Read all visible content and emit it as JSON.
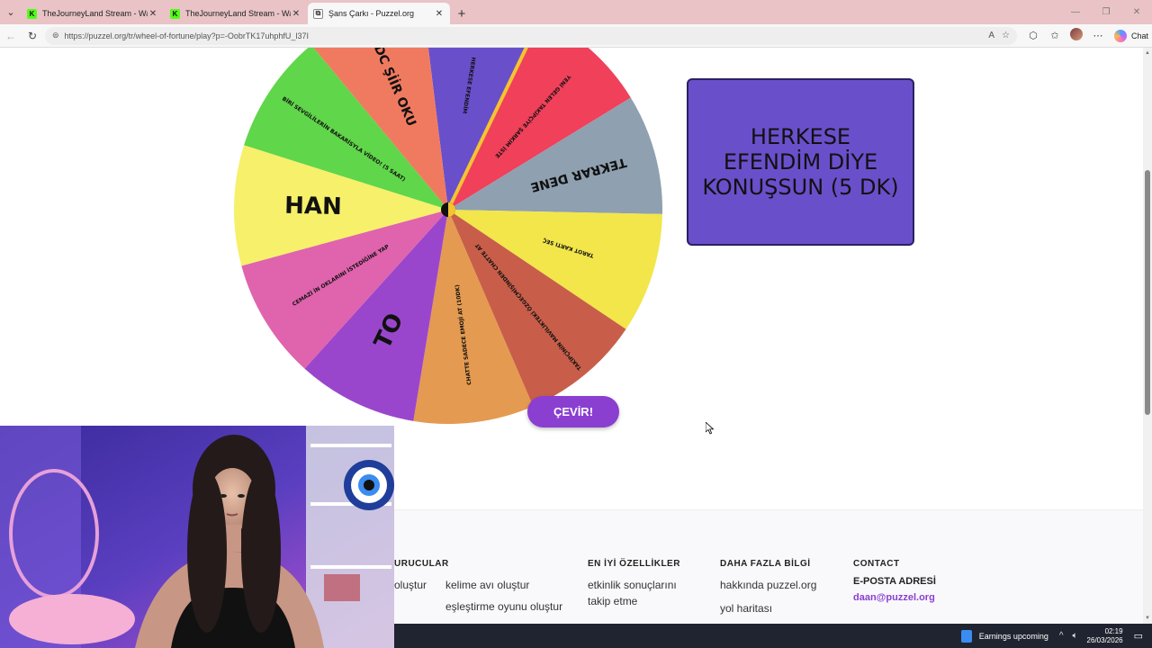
{
  "browser": {
    "tabs": [
      {
        "title": "TheJourneyLand Stream - Watch L",
        "favicon": "kick-icon",
        "active": false
      },
      {
        "title": "TheJourneyLand Stream - Watch L",
        "favicon": "kick-icon",
        "active": false
      },
      {
        "title": "Şans Çarkı - Puzzel.org",
        "favicon": "puzzel-icon",
        "active": true
      }
    ],
    "url": "https://puzzel.org/tr/wheel-of-fortune/play?p=-OobrTK17uhphfU_l37I",
    "chat_label": "Chat"
  },
  "wheel": {
    "segments": [
      {
        "label": "HERKESE EFENDİM",
        "color": "#6a4fcb"
      },
      {
        "label": "YENİ GELEN TAKİPÇİYE ŞARKIM İSTE",
        "color": "#f0405a"
      },
      {
        "label": "TEKRAR DENE",
        "color": "#8fa0b0"
      },
      {
        "label": "TAROT KARTI SEÇ",
        "color": "#f2e64a"
      },
      {
        "label": "TAKİPÇİNİN MAVİLİKTEKİ ÖZGEÇMİŞİNDEN CHATTE AT",
        "color": "#c85e4a"
      },
      {
        "label": "CHATTE SADECE EMOJİ AT (10DK)",
        "color": "#e49a50"
      },
      {
        "label": "TO",
        "color": "#9a46cc"
      },
      {
        "label": "CEMAZİ İN OKLARINI İSTEDİĞİNE YAP",
        "color": "#e063ad"
      },
      {
        "label": "HAN",
        "color": "#f7f06a"
      },
      {
        "label": "BİRİ SEVGİLİLERİN BAKARİSYLA VİDEO! (5 SAAT)",
        "color": "#60d64a"
      },
      {
        "label": "DC ŞİİR OKU",
        "color": "#f07a60"
      }
    ]
  },
  "result": {
    "text": "HERKESE EFENDİM DİYE KONUŞSUN (5 DK)"
  },
  "spin_button": {
    "label": "ÇEVİR!"
  },
  "footer": {
    "col1": {
      "heading": "URUCULAR",
      "links": [
        "oluştur"
      ]
    },
    "col1b": {
      "links": [
        "kelime avı oluştur",
        "eşleştirme oyunu oluştur"
      ]
    },
    "col2": {
      "heading": "EN İYİ ÖZELLİKLER",
      "links": [
        "etkinlik sonuçlarını takip etme"
      ]
    },
    "col3": {
      "heading": "DAHA FAZLA BİLGİ",
      "links": [
        "hakkında puzzel.org",
        "yol haritası"
      ]
    },
    "col4": {
      "heading": "CONTACT",
      "email_label": "E-POSTA ADRESİ",
      "email": "daan@puzzel.org"
    }
  },
  "taskbar": {
    "news": "Earnings upcoming",
    "time": "02:19",
    "date": "26/03/2026"
  },
  "colors": {
    "accent": "#8a3fd0",
    "result_bg": "#6a4fcb"
  }
}
